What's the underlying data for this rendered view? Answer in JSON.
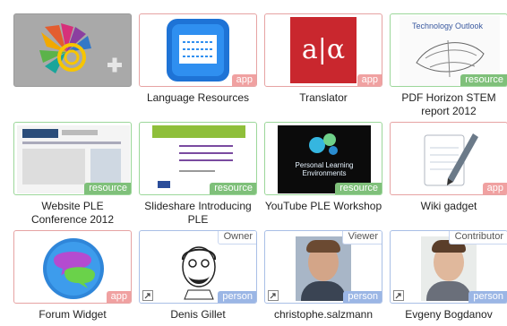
{
  "tiles": [
    {
      "id": "add-widget",
      "title": "",
      "label": "",
      "role": "",
      "kind": "empty"
    },
    {
      "id": "language-resources",
      "title": "Language Resources",
      "label": "app",
      "role": "",
      "kind": "app"
    },
    {
      "id": "translator",
      "title": "Translator",
      "label": "app",
      "role": "",
      "kind": "app",
      "thumb_text": "a|α"
    },
    {
      "id": "pdf-horizon",
      "title": "PDF Horizon STEM report 2012",
      "label": "resource",
      "role": "",
      "kind": "resource",
      "thumb_text": "Technology Outlook"
    },
    {
      "id": "website-ple",
      "title": "Website PLE Conference 2012",
      "label": "resource",
      "role": "",
      "kind": "resource"
    },
    {
      "id": "slideshare",
      "title": "Slideshare Introducing PLE",
      "label": "resource",
      "role": "",
      "kind": "resource"
    },
    {
      "id": "youtube-ple",
      "title": "YouTube PLE Workshop",
      "label": "resource",
      "role": "",
      "kind": "resource",
      "thumb_text": "Personal Learning Environments"
    },
    {
      "id": "wiki-gadget",
      "title": "Wiki gadget",
      "label": "app",
      "role": "",
      "kind": "app"
    },
    {
      "id": "forum-widget",
      "title": "Forum Widget",
      "label": "app",
      "role": "",
      "kind": "app"
    },
    {
      "id": "denis-gillet",
      "title": "Denis Gillet",
      "label": "person",
      "role": "Owner",
      "kind": "person"
    },
    {
      "id": "christophe",
      "title": "christophe.salzmann",
      "label": "person",
      "role": "Viewer",
      "kind": "person"
    },
    {
      "id": "evgeny",
      "title": "Evgeny Bogdanov",
      "label": "person",
      "role": "Contributor",
      "kind": "person"
    }
  ],
  "colors": {
    "app": "#f0a1a1",
    "resource": "#7fc07a",
    "person": "#9bb6e5",
    "empty_bg": "#a9a9a9"
  }
}
